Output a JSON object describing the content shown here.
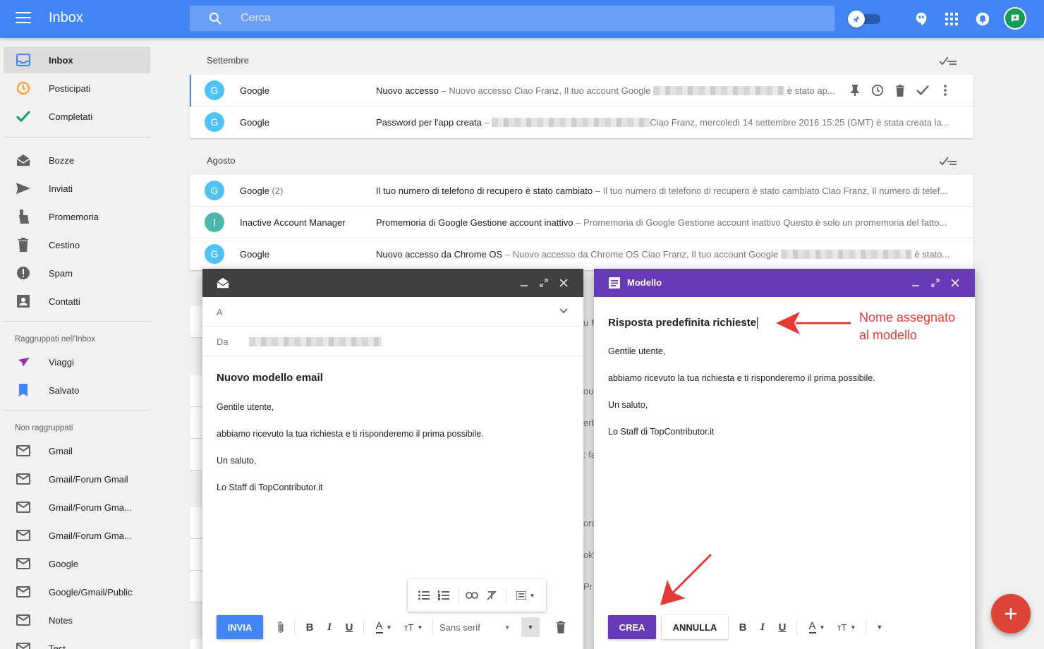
{
  "app": {
    "title": "Inbox"
  },
  "search": {
    "placeholder": "Cerca"
  },
  "colors": {
    "topbar": "#4285f4",
    "purple": "#673ab7",
    "dark_header": "#404040",
    "fab": "#db4437",
    "send_button": "#4285f4"
  },
  "sidebar": {
    "items": [
      {
        "label": "Inbox",
        "icon": "inbox-icon",
        "active": true
      },
      {
        "label": "Posticipati",
        "icon": "clock-icon"
      },
      {
        "label": "Completati",
        "icon": "check-icon"
      },
      {
        "label": "Bozze",
        "icon": "drafts-icon"
      },
      {
        "label": "Inviati",
        "icon": "send-icon"
      },
      {
        "label": "Promemoria",
        "icon": "reminder-icon"
      },
      {
        "label": "Cestino",
        "icon": "trash-icon"
      },
      {
        "label": "Spam",
        "icon": "spam-icon"
      },
      {
        "label": "Contatti",
        "icon": "contacts-icon"
      }
    ],
    "bundled_label": "Raggruppati nell'Inbox",
    "bundled": [
      {
        "label": "Viaggi",
        "icon": "plane-icon"
      },
      {
        "label": "Salvato",
        "icon": "bookmark-icon"
      }
    ],
    "unbundled_label": "Non raggruppati",
    "unbundled": [
      {
        "label": "Gmail"
      },
      {
        "label": "Gmail/Forum Gmail"
      },
      {
        "label": "Gmail/Forum Gma..."
      },
      {
        "label": "Gmail/Forum Gma..."
      },
      {
        "label": "Google"
      },
      {
        "label": "Google/Gmail/Public"
      },
      {
        "label": "Notes"
      },
      {
        "label": "Test"
      }
    ]
  },
  "groups": [
    {
      "label": "Settembre",
      "rows": [
        {
          "initial": "G",
          "sender": "Google",
          "count": "",
          "subject": "Nuovo accesso",
          "pre1": " – Nuovo accesso Ciao Franz, Il tuo account Google ",
          "pre2": " è stato ap...",
          "redact": 186
        },
        {
          "initial": "G",
          "sender": "Google",
          "count": "",
          "subject": "Password per l'app creata",
          "pre1": " – ",
          "pre2": "Ciao Franz, mercoledì 14 settembre 2016 15:25 (GMT) è stata creata la...",
          "redact": 224
        }
      ]
    },
    {
      "label": "Agosto",
      "rows": [
        {
          "initial": "G",
          "sender": "Google",
          "count": "(2)",
          "subject": "Il tuo numero di telefono di recupero è stato cambiato",
          "pre1": " – Il tuo numero di telefono di recupero è stato cambiato Ciao Franz, Il numero di telef...",
          "pre2": "",
          "redact": 0
        },
        {
          "initial": "I",
          "sender": "Inactive Account Manager",
          "count": "",
          "subject": "Promemoria di Google Gestione account inattivo",
          "pre1": " – Promemoria di Google Gestione account inattivo Questo è solo un promemoria del fatto...",
          "pre2": "",
          "redact": 0
        },
        {
          "initial": "G",
          "sender": "Google",
          "count": "",
          "subject": "Nuovo accesso da Chrome OS",
          "pre1": " – Nuovo accesso da Chrome OS Ciao Franz, Il tuo account Google ",
          "pre2": " è stato...",
          "redact": 186
        }
      ]
    }
  ],
  "peek": [
    "u M",
    "ou",
    "erb",
    ": fa",
    "ora",
    "ok\"",
    "Pr"
  ],
  "compose": {
    "to_label": "A",
    "from_label": "Da",
    "subject": "Nuovo modello email",
    "body": [
      "Gentile utente,",
      "abbiamo ricevuto la tua richiesta e ti risponderemo il prima possibile.",
      "Un saluto,",
      "Lo Staff di TopContributor.it"
    ],
    "send": "INVIA",
    "font": "Sans serif"
  },
  "template": {
    "title": "Modello",
    "name": "Risposta predefinita richieste",
    "body": [
      "Gentile utente,",
      "abbiamo ricevuto la tua richiesta e ti risponderemo il prima possibile.",
      "Un saluto,",
      "Lo Staff di TopContributor.it"
    ],
    "create": "CREA",
    "cancel": "ANNULLA"
  },
  "annotation": {
    "line1": "Nome assegnato",
    "line2": "al modello"
  }
}
